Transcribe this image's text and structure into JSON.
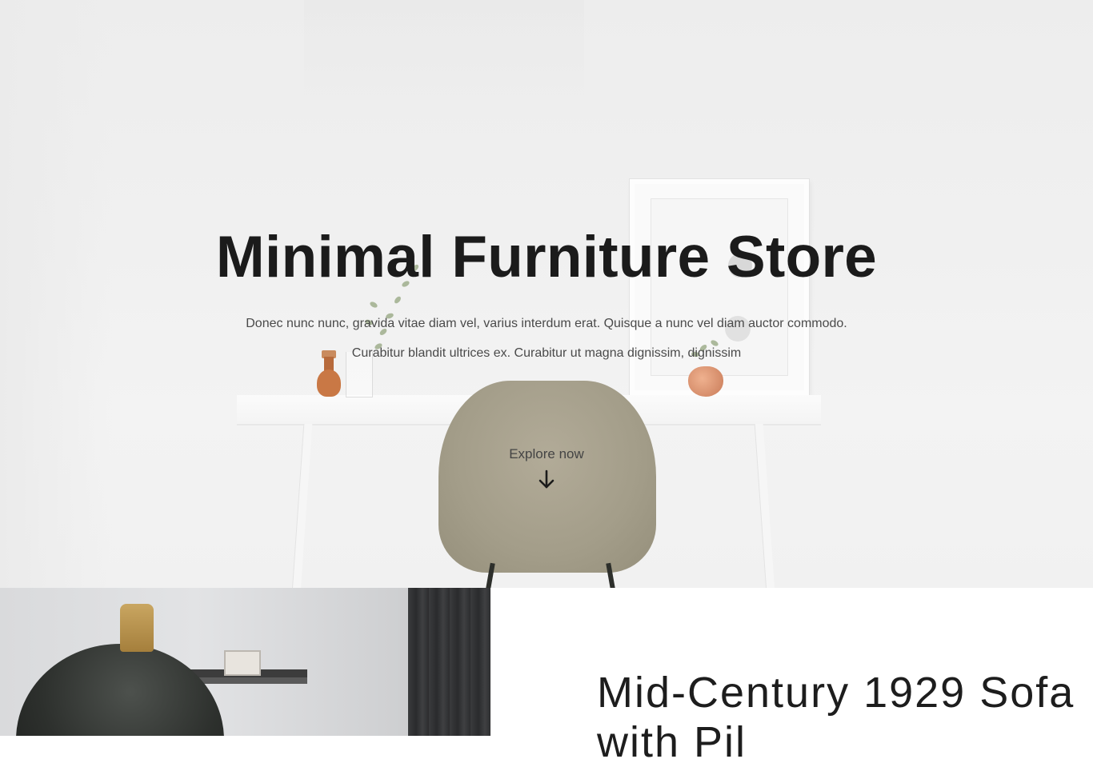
{
  "hero": {
    "title": "Minimal Furniture Store",
    "description": "Donec nunc nunc, gravida vitae diam vel, varius interdum erat. Quisque a nunc vel diam auctor commodo. Curabitur blandit ultrices ex. Curabitur ut magna dignissim, dignissim",
    "cta_label": "Explore now",
    "cta_icon": "arrow-down-icon"
  },
  "feature": {
    "title": "Mid-Century 1929 Sofa with Pil"
  },
  "colors": {
    "text_dark": "#1b1b1b",
    "text_muted": "#4a4a4a",
    "hero_bg": "#f0f0f0",
    "accent_copper": "#c97845"
  }
}
